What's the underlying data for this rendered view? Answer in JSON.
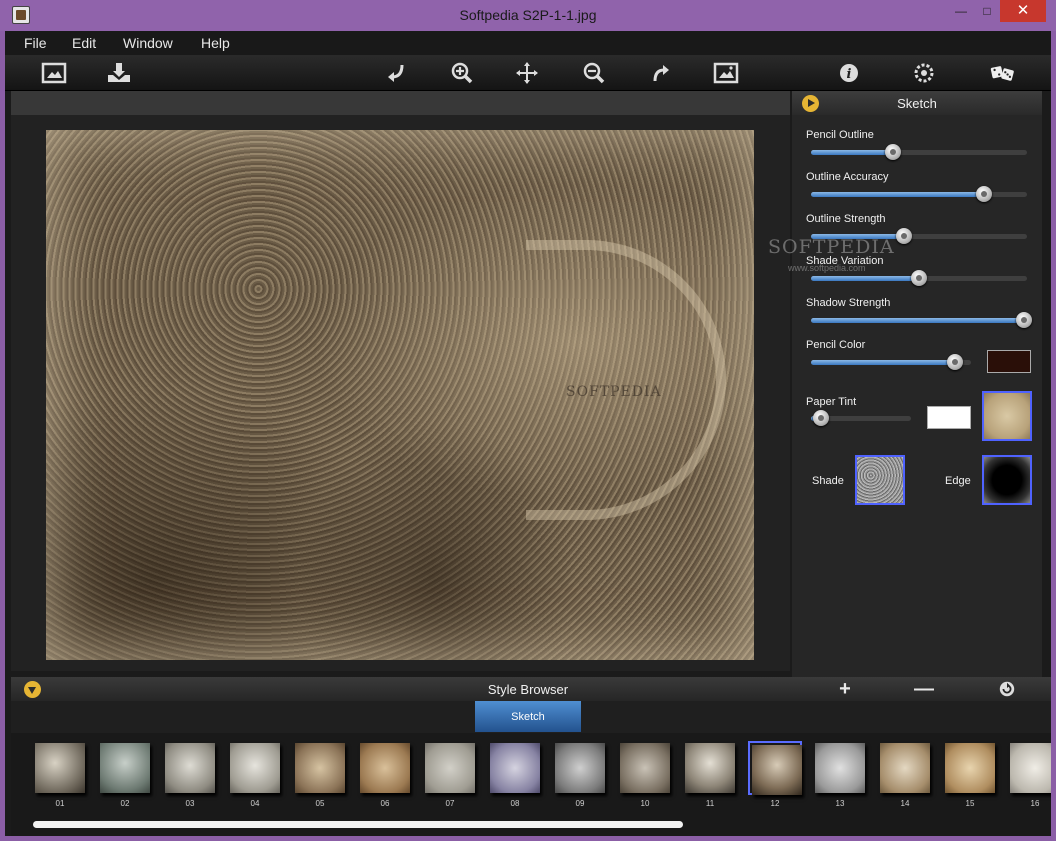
{
  "window": {
    "title": "Softpedia S2P-1-1.jpg",
    "controls": [
      "—",
      "□",
      "✕"
    ]
  },
  "menu": [
    "File",
    "Edit",
    "Window",
    "Help"
  ],
  "toolbar_icons": [
    "open-image-icon",
    "save-icon",
    "undo-icon",
    "zoom-in-icon",
    "pan-icon",
    "zoom-out-icon",
    "redo-icon",
    "fit-image-icon",
    "info-icon",
    "settings-icon",
    "random-dice-icon"
  ],
  "watermark": {
    "brand": "SOFTPEDIA",
    "url": "www.softpedia.com"
  },
  "panel": {
    "title": "Sketch",
    "sliders": [
      {
        "label": "Pencil Outline",
        "value": 0.38
      },
      {
        "label": "Outline Accuracy",
        "value": 0.8
      },
      {
        "label": "Outline Strength",
        "value": 0.43
      },
      {
        "label": "Shade Variation",
        "value": 0.5
      },
      {
        "label": "Shadow Strength",
        "value": 1.0
      },
      {
        "label": "Pencil Color",
        "value": 0.9
      },
      {
        "label": "Paper Tint",
        "value": 0.1
      }
    ],
    "pencil_color": "#2a0f08",
    "paper_tint_color": "#ffffff",
    "shade_label": "Shade",
    "edge_label": "Edge"
  },
  "style_browser": {
    "title": "Style Browser",
    "active_tab": "Sketch",
    "selected": "12",
    "thumbs": [
      "01",
      "02",
      "03",
      "04",
      "05",
      "06",
      "07",
      "08",
      "09",
      "10",
      "11",
      "12",
      "13",
      "14",
      "15",
      "16"
    ],
    "scroll_position": 0.0
  },
  "colors": {
    "accent_blue": "#3a78c0",
    "button_yellow": "#e6b534",
    "selection": "#5a6cff"
  }
}
